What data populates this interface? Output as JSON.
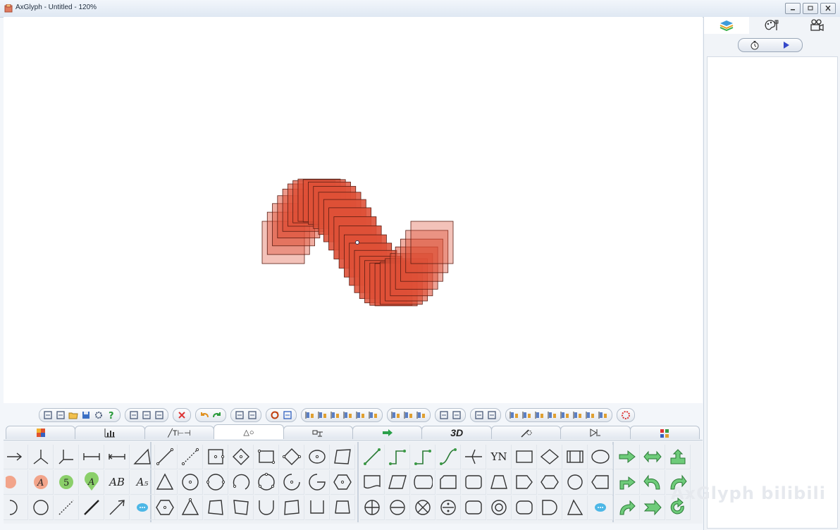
{
  "window": {
    "title": "AxGlyph - Untitled - 120%"
  },
  "colors": {
    "shape_fill": "#e8836f",
    "shape_dark": "#cc3a22",
    "accent": "#3a9a45",
    "selected_tab": "#ffffff"
  },
  "right_panel": {
    "tabs": [
      {
        "icon": "layers-icon"
      },
      {
        "icon": "palette-icon"
      },
      {
        "icon": "camera-icon"
      }
    ],
    "buttons": [
      {
        "icon": "timer-icon"
      },
      {
        "icon": "play-icon"
      }
    ]
  },
  "bottom_tabs": [
    {
      "icon": "color-swatch-icon"
    },
    {
      "icon": "chart-icon"
    },
    {
      "label": "╱T⊢⊣",
      "icon": "text-line-icon"
    },
    {
      "label": "△○",
      "icon": "shapes-icon",
      "active": true
    },
    {
      "icon": "circuit-icon"
    },
    {
      "icon": "arrow-icon"
    },
    {
      "label": "3D",
      "icon": "3d-icon"
    },
    {
      "icon": "magic-icon"
    },
    {
      "icon": "diode-icon"
    },
    {
      "icon": "grid-icon"
    }
  ],
  "palette_text": {
    "ab": "AB",
    "a5": "A₅",
    "yn": "YN",
    "five": "5",
    "a_label": "A"
  },
  "watermark": "AxGlyph bilibili"
}
